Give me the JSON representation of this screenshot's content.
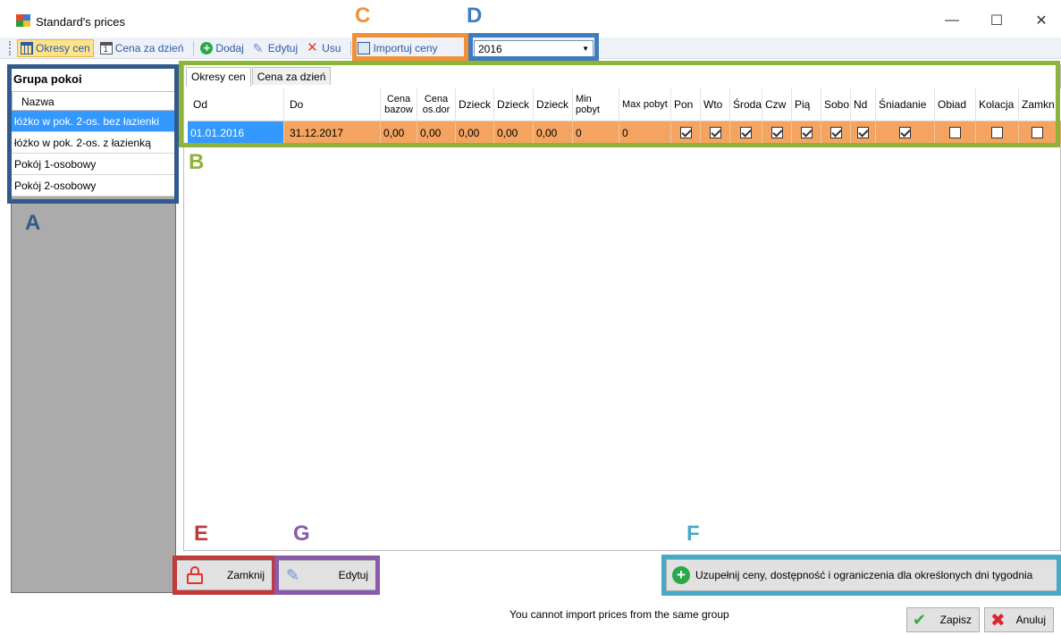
{
  "window": {
    "title": "Standard's prices",
    "minimize": "—",
    "maximize": "☐",
    "close": "✕"
  },
  "toolbar": {
    "okresy_cen": "Okresy cen",
    "cena_za_dzien": "Cena za dzień",
    "dodaj": "Dodaj",
    "edytuj": "Edytuj",
    "usun": "Usu",
    "importuj": "Importuj ceny"
  },
  "year_select": {
    "value": "2016"
  },
  "left_panel": {
    "title": "Grupa pokoi",
    "column": "Nazwa",
    "items": [
      "łóżko w pok. 2-os. bez łazienki",
      "łóżko w pok. 2-os. z łazienką",
      "Pokój 1-osobowy",
      "Pokój 2-osobowy"
    ]
  },
  "tabs": [
    "Okresy cen",
    "Cena za dzień"
  ],
  "grid": {
    "headers": [
      "Od",
      "Do",
      "Cena bazow",
      "Cena os.dor",
      "Dzieck",
      "Dzieck",
      "Dzieck",
      "Min pobyt",
      "Max pobyt",
      "Pon",
      "Wto",
      "Środa",
      "Czw",
      "Pią",
      "Sobo",
      "Nd",
      "Śniadanie",
      "Obiad",
      "Kolacja",
      "Zamkn"
    ],
    "row": {
      "od": "01.01.2016",
      "do": "31.12.2017",
      "cena_bazowa": "0,00",
      "cena_os_dod": "0,00",
      "dziecko1": "0,00",
      "dziecko2": "0,00",
      "dziecko3": "0,00",
      "min_pobyt": "0",
      "max_pobyt": "0",
      "checks": [
        true,
        true,
        true,
        true,
        true,
        true,
        true,
        true,
        false,
        false,
        false
      ]
    }
  },
  "buttons": {
    "zamknij": "Zamknij",
    "edytuj": "Edytuj",
    "uzupelnij": "Uzupełnij ceny, dostępność i ograniczenia dla określonych dni tygodnia",
    "zapisz": "Zapisz",
    "anuluj": "Anuluj"
  },
  "status": "You cannot import prices from the same group",
  "annotations": [
    {
      "letter": "A",
      "color": "#2f5b8c"
    },
    {
      "letter": "B",
      "color": "#8db33a"
    },
    {
      "letter": "C",
      "color": "#f0913a"
    },
    {
      "letter": "D",
      "color": "#3e7cc0"
    },
    {
      "letter": "E",
      "color": "#c0393b"
    },
    {
      "letter": "F",
      "color": "#46aac4"
    },
    {
      "letter": "G",
      "color": "#8a5aa8"
    }
  ]
}
